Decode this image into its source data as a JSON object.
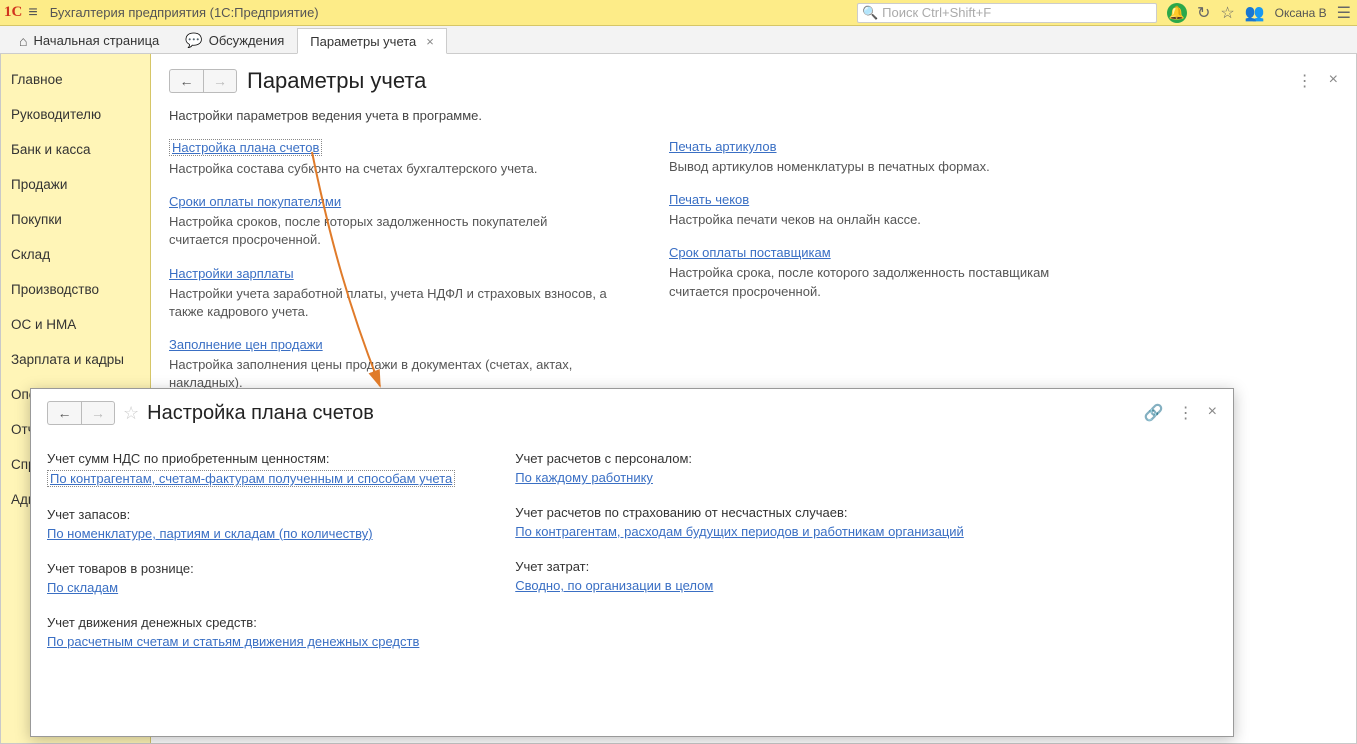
{
  "titlebar": {
    "app_title": "Бухгалтерия предприятия  (1С:Предприятие)",
    "search_placeholder": "Поиск Ctrl+Shift+F",
    "user": "Оксана В"
  },
  "tabs": {
    "home": "Начальная страница",
    "discuss": "Обсуждения",
    "active": "Параметры учета"
  },
  "sidebar": {
    "items": [
      "Главное",
      "Руководителю",
      "Банк и касса",
      "Продажи",
      "Покупки",
      "Склад",
      "Производство",
      "ОС и НМА",
      "Зарплата и кадры",
      "Опе",
      "Отч",
      "Спр",
      "Адм"
    ]
  },
  "page": {
    "title": "Параметры учета",
    "description": "Настройки параметров ведения учета в программе.",
    "left": {
      "link1": "Настройка плана счетов",
      "desc1": "Настройка состава субконто на счетах бухгалтерского учета.",
      "link2": "Сроки оплаты покупателями",
      "desc2": "Настройка сроков, после которых задолженность покупателей считается просроченной.",
      "link3": "Настройки зарплаты",
      "desc3": "Настройки учета заработной платы, учета НДФЛ и страховых взносов, а также кадрового учета.",
      "link4": "Заполнение цен продажи",
      "desc4": "Настройка заполнения цены продажи в документах (счетах, актах, накладных)."
    },
    "right": {
      "link1": "Печать артикулов",
      "desc1": "Вывод артикулов номенклатуры в печатных формах.",
      "link2": "Печать чеков",
      "desc2": "Настройка печати чеков на онлайн кассе.",
      "link3": "Срок оплаты поставщикам",
      "desc3": "Настройка срока, после которого задолженность поставщикам считается просроченной."
    }
  },
  "modal": {
    "title": "Настройка плана счетов",
    "left": {
      "label1": "Учет сумм НДС по приобретенным ценностям:",
      "link1": "По контрагентам, счетам-фактурам полученным и способам учета",
      "label2": "Учет запасов:",
      "link2": "По номенклатуре, партиям и складам (по количеству)",
      "label3": "Учет товаров в рознице:",
      "link3": "По складам",
      "label4": "Учет движения денежных средств:",
      "link4": "По расчетным счетам и статьям движения денежных средств"
    },
    "right": {
      "label1": "Учет расчетов с персоналом:",
      "link1": "По каждому работнику",
      "label2": "Учет расчетов по страхованию от несчастных случаев:",
      "link2": "По контрагентам, расходам будущих периодов и работникам организаций",
      "label3": "Учет затрат:",
      "link3": "Сводно, по организации в целом"
    }
  }
}
